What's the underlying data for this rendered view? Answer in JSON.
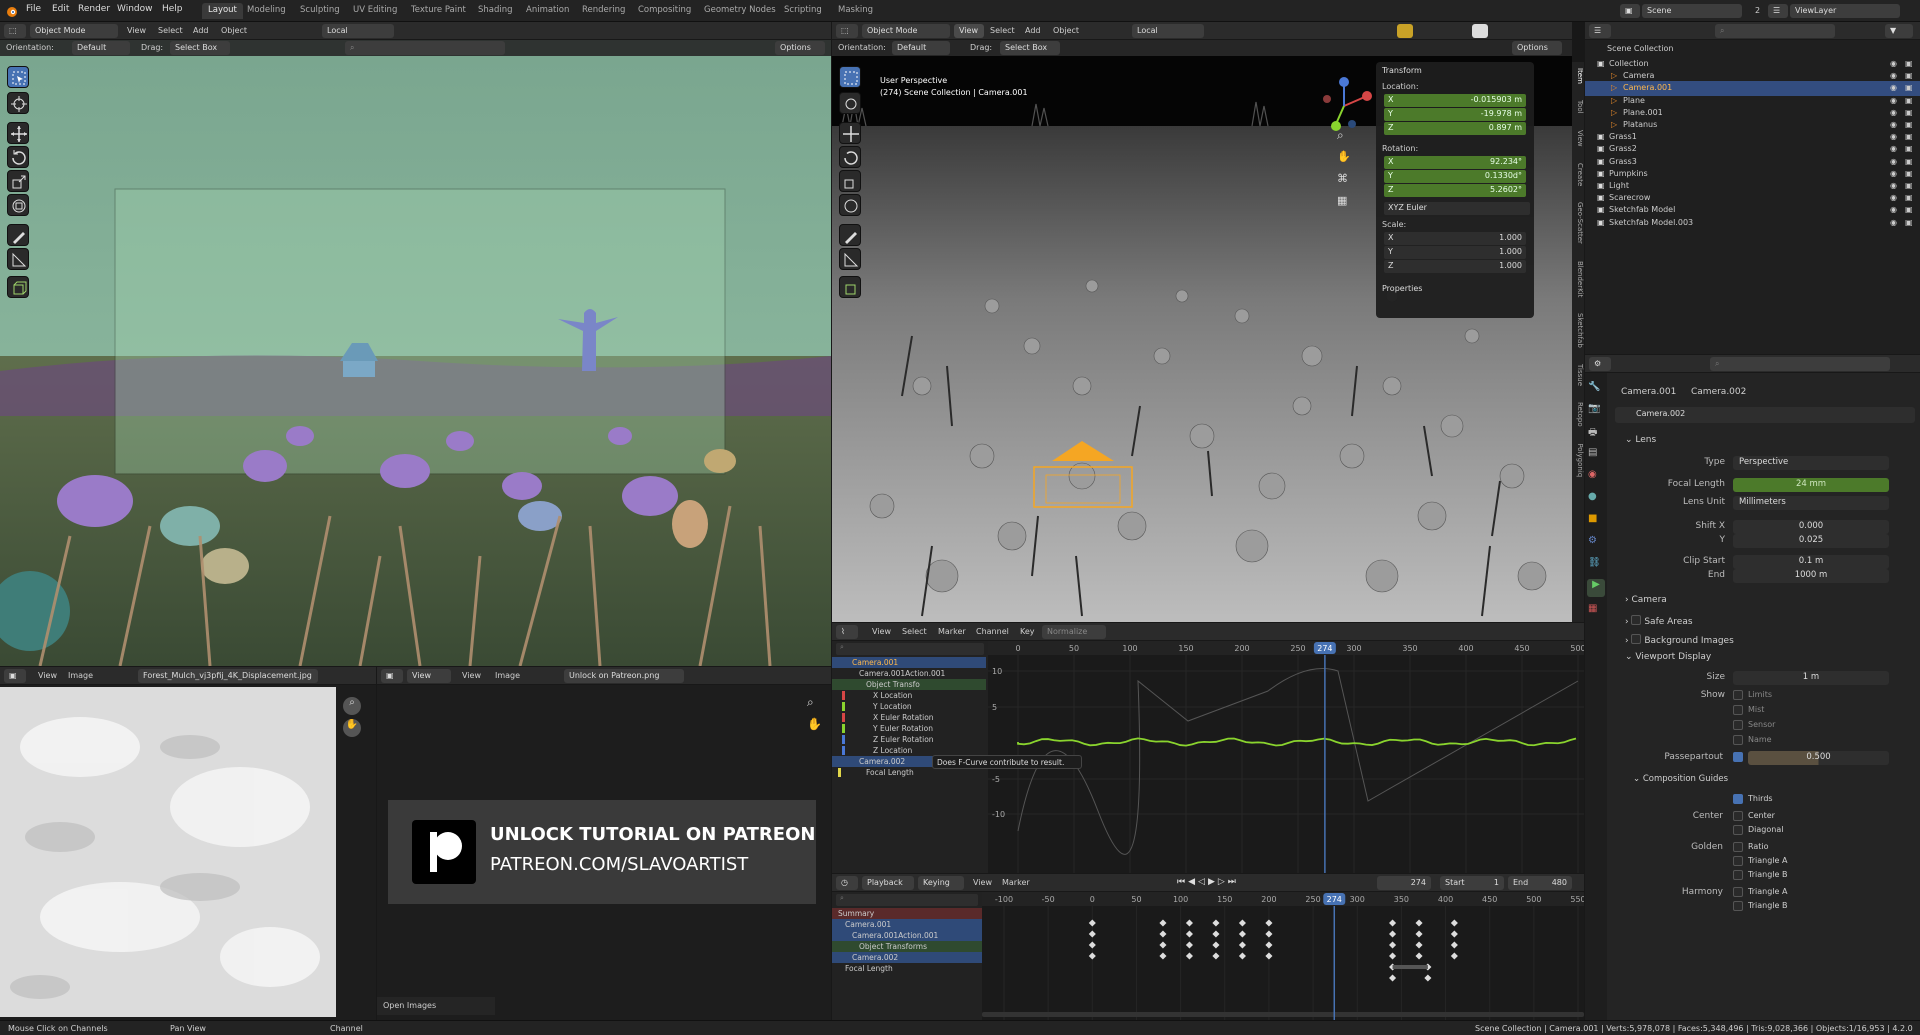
{
  "top_menu": [
    "File",
    "Edit",
    "Render",
    "Window",
    "Help"
  ],
  "workspaces": [
    "Layout",
    "Modeling",
    "Sculpting",
    "UV Editing",
    "Texture Paint",
    "Shading",
    "Animation",
    "Rendering",
    "Compositing",
    "Geometry Nodes",
    "Scripting",
    "Masking"
  ],
  "scene": {
    "scene": "Scene",
    "count": "2",
    "view_layer": "ViewLayer"
  },
  "left_viewport": {
    "mode": "Object Mode",
    "menus": [
      "View",
      "Select",
      "Add",
      "Object"
    ],
    "transform": "Local",
    "orientation_label": "Orientation:",
    "orientation": "Default",
    "drag_label": "Drag:",
    "drag": "Select Box",
    "options": "Options"
  },
  "right_viewport": {
    "mode": "Object Mode",
    "menus": [
      "View",
      "Select",
      "Add",
      "Object"
    ],
    "transform": "Local",
    "orientation_label": "Orientation:",
    "orientation": "Default",
    "drag_label": "Drag:",
    "drag": "Select Box",
    "options": "Options",
    "perspective": "User Perspective",
    "collection_line": "(274) Scene Collection | Camera.001"
  },
  "npanel": {
    "title": "Transform",
    "location": "Location:",
    "loc": [
      {
        "axis": "X",
        "value": "-0.015903 m"
      },
      {
        "axis": "Y",
        "value": "-19.978 m"
      },
      {
        "axis": "Z",
        "value": "0.897 m"
      }
    ],
    "rotation": "Rotation:",
    "rot": [
      {
        "axis": "X",
        "value": "92.234°"
      },
      {
        "axis": "Y",
        "value": "0.1330d°"
      },
      {
        "axis": "Z",
        "value": "5.2602°"
      }
    ],
    "rot_mode": "XYZ Euler",
    "scale": "Scale:",
    "scl": [
      {
        "axis": "X",
        "value": "1.000"
      },
      {
        "axis": "Y",
        "value": "1.000"
      },
      {
        "axis": "Z",
        "value": "1.000"
      }
    ],
    "properties": "Properties",
    "tabs": [
      "Item",
      "Tool",
      "View",
      "Create",
      "Geo-Scatter",
      "BlenderKit",
      "Sketchfab",
      "Tissue",
      "Retopo",
      "Polygoniq"
    ]
  },
  "image_editor_left": {
    "menus": [
      "View",
      "Image"
    ],
    "image": "Forest_Mulch_vj3pfij_4K_Displacement.jpg"
  },
  "image_editor_right": {
    "view": "View",
    "menus": [
      "View",
      "Image"
    ],
    "image": "Unlock on Patreon.png",
    "open_images": "Open Images"
  },
  "patreon": {
    "line1": "UNLOCK TUTORIAL ON PATREON",
    "line2": "PATREON.COM/SLAVOARTIST"
  },
  "graph_editor": {
    "menus": [
      "View",
      "Select",
      "Marker",
      "Channel",
      "Key"
    ],
    "normalize": "Normalize",
    "current_frame": "274",
    "frames": [
      "0",
      "50",
      "100",
      "150",
      "200",
      "250",
      "300",
      "350",
      "400",
      "450",
      "500"
    ],
    "y_labels": [
      "10",
      "5",
      "-5",
      "-10"
    ],
    "tooltip": "Does F-Curve contribute to result.",
    "channels": [
      {
        "name": "Camera.001",
        "level": 0,
        "color": "#4e6ea8"
      },
      {
        "name": "Camera.001Action.001",
        "level": 1,
        "color": ""
      },
      {
        "name": "Object Transfo",
        "level": 2,
        "color": "#375c37"
      },
      {
        "name": "X Location",
        "level": 3,
        "color": "#d64646"
      },
      {
        "name": "Y Location",
        "level": 3,
        "color": "#8ad42e"
      },
      {
        "name": "X Euler Rotation",
        "level": 3,
        "color": "#d64646"
      },
      {
        "name": "Y Euler Rotation",
        "level": 3,
        "color": "#8ad42e"
      },
      {
        "name": "Z Euler Rotation",
        "level": 3,
        "color": "#4a78d6"
      },
      {
        "name": "Z Location",
        "level": 3,
        "color": "#4a78d6"
      },
      {
        "name": "Camera.002",
        "level": 1,
        "color": "#4e6ea8"
      },
      {
        "name": "Focal Length",
        "level": 2,
        "color": "#e0d64a"
      }
    ]
  },
  "timeline": {
    "menus": [
      "Playback",
      "Keying",
      "View",
      "Marker"
    ],
    "frame": "274",
    "start_label": "Start",
    "start": "1",
    "end_label": "End",
    "end": "480",
    "frames": [
      "-100",
      "-50",
      "0",
      "50",
      "100",
      "150",
      "200",
      "250",
      "300",
      "350",
      "400",
      "450",
      "500",
      "550"
    ],
    "channels": [
      "Summary",
      "Camera.001",
      "Camera.001Action.001",
      "Object Transforms",
      "Camera.002",
      "Focal Length"
    ]
  },
  "outliner": {
    "root": "Scene Collection",
    "items": [
      {
        "name": "Collection",
        "depth": 0
      },
      {
        "name": "Camera",
        "depth": 1
      },
      {
        "name": "Camera.001",
        "depth": 1,
        "selected": true
      },
      {
        "name": "Plane",
        "depth": 1
      },
      {
        "name": "Plane.001",
        "depth": 1
      },
      {
        "name": "Platanus",
        "depth": 1
      },
      {
        "name": "Grass1",
        "depth": 0
      },
      {
        "name": "Grass2",
        "depth": 0
      },
      {
        "name": "Grass3",
        "depth": 0
      },
      {
        "name": "Pumpkins",
        "depth": 0
      },
      {
        "name": "Light",
        "depth": 0
      },
      {
        "name": "Scarecrow",
        "depth": 0
      },
      {
        "name": "Sketchfab Model",
        "depth": 0
      },
      {
        "name": "Sketchfab Model.003",
        "depth": 0
      }
    ]
  },
  "properties": {
    "breadcrumb_object": "Camera.001",
    "breadcrumb_data": "Camera.002",
    "datablock": "Camera.002",
    "lens_section": "Lens",
    "type_label": "Type",
    "type": "Perspective",
    "focal_label": "Focal Length",
    "focal": "24 mm",
    "unit_label": "Lens Unit",
    "unit": "Millimeters",
    "shiftx_label": "Shift X",
    "shiftx": "0.000",
    "shifty_label": "Y",
    "shifty": "0.025",
    "clipstart_label": "Clip Start",
    "clipstart": "0.1 m",
    "clipend_label": "End",
    "clipend": "1000 m",
    "camera_section": "Camera",
    "safe_areas": "Safe Areas",
    "bg_images": "Background Images",
    "viewport_display": "Viewport Display",
    "size_label": "Size",
    "size": "1 m",
    "show_label": "Show",
    "limits": "Limits",
    "mist": "Mist",
    "sensor": "Sensor",
    "name": "Name",
    "passepartout_label": "Passepartout",
    "passepartout": "0.500",
    "comp_guides": "Composition Guides",
    "thirds": "Thirds",
    "center_label": "Center",
    "center": "Center",
    "diagonal": "Diagonal",
    "golden_label": "Golden",
    "ratio": "Ratio",
    "triangle_a": "Triangle A",
    "triangle_b": "Triangle B",
    "harmony_label": "Harmony",
    "h_triangle_a": "Triangle A",
    "h_triangle_b": "Triangle B"
  },
  "status": {
    "left1": "Mouse Click on Channels",
    "left2": "Pan View",
    "left3": "Channel",
    "right": "Scene Collection | Camera.001 | Verts:5,978,078 | Faces:5,348,496 | Tris:9,028,366 | Objects:1/16,953 | 4.2.0"
  },
  "colors": {
    "accent": "#4772b3",
    "green_field": "#4c7a2a",
    "orange_select": "#f5a623",
    "playhead": "#4772b3",
    "curve_green": "#8ad42e"
  }
}
